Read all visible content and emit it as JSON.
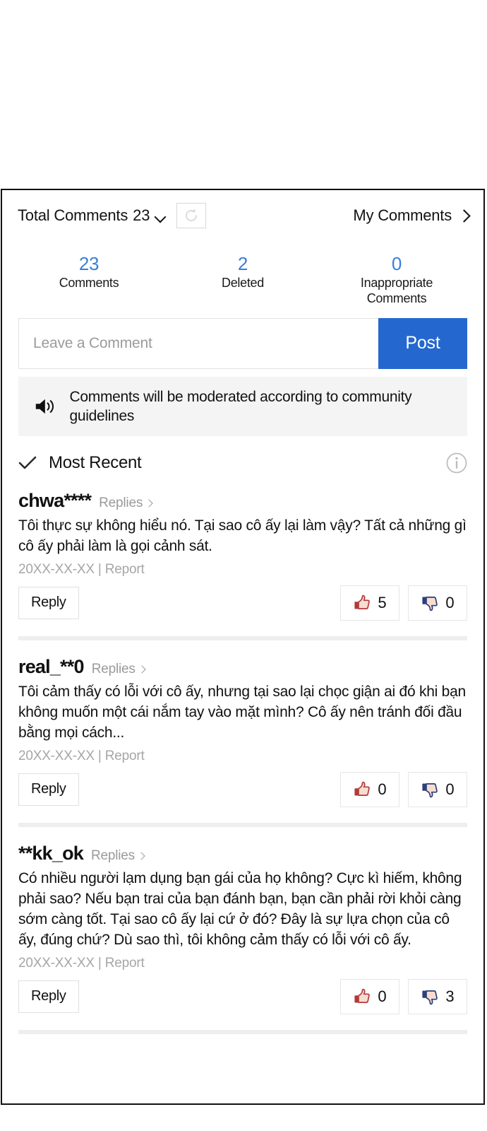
{
  "header": {
    "total_comments_label": "Total Comments",
    "total_comments_count": "23",
    "dropdown_icon": "chevron-down-icon",
    "refresh_icon": "refresh-icon",
    "my_comments_label": "My Comments",
    "my_comments_chevron": "chevron-right-icon"
  },
  "stats": [
    {
      "value": "23",
      "label": "Comments"
    },
    {
      "value": "2",
      "label": "Deleted"
    },
    {
      "value": "0",
      "label": "Inappropriate Comments"
    }
  ],
  "composer": {
    "placeholder": "Leave a Comment",
    "value": "",
    "post_label": "Post"
  },
  "notice": {
    "icon": "speaker-icon",
    "text": "Comments will be moderated according to community guidelines"
  },
  "sort": {
    "check_icon": "check-icon",
    "label": "Most Recent",
    "info_icon": "info-icon"
  },
  "comments": [
    {
      "user": "chwa****",
      "replies_label": "Replies",
      "body": "Tôi thực sự không hiểu nó. Tại sao cô ấy lại làm vậy? Tất cả những gì cô ấy phải làm là gọi cảnh sát.",
      "date": "20XX-XX-XX",
      "separator": "|",
      "report_label": "Report",
      "reply_label": "Reply",
      "likes": "5",
      "dislikes": "0"
    },
    {
      "user": "real_**0",
      "replies_label": "Replies",
      "body": "Tôi cảm thấy có lỗi với cô ấy, nhưng tại sao lại chọc giận ai đó khi bạn không muốn một cái nắm tay vào mặt mình? Cô ấy nên tránh đối đầu bằng mọi cách...",
      "date": "20XX-XX-XX",
      "separator": "|",
      "report_label": "Report",
      "reply_label": "Reply",
      "likes": "0",
      "dislikes": "0"
    },
    {
      "user": "**kk_ok",
      "replies_label": "Replies",
      "body": "Có nhiều người lạm dụng bạn gái của họ không? Cực kì hiếm, không phải sao? Nếu bạn trai của bạn đánh bạn, bạn cần phải rời khỏi càng sớm càng tốt. Tại sao cô ấy lại cứ ở đó? Đây là sự lựa chọn của cô ấy, đúng chứ? Dù sao thì, tôi không cảm thấy có lỗi với cô ấy.",
      "date": "20XX-XX-XX",
      "separator": "|",
      "report_label": "Report",
      "reply_label": "Reply",
      "likes": "0",
      "dislikes": "3"
    }
  ],
  "colors": {
    "accent_blue": "#2467cf",
    "stat_blue": "#3a7ed6",
    "like_red": "#b23a3a",
    "dislike_blue": "#2b3f7a",
    "thumb_fill": "#f7ddd0",
    "notice_bg": "#f4f4f4",
    "divider": "#eeeeee"
  }
}
